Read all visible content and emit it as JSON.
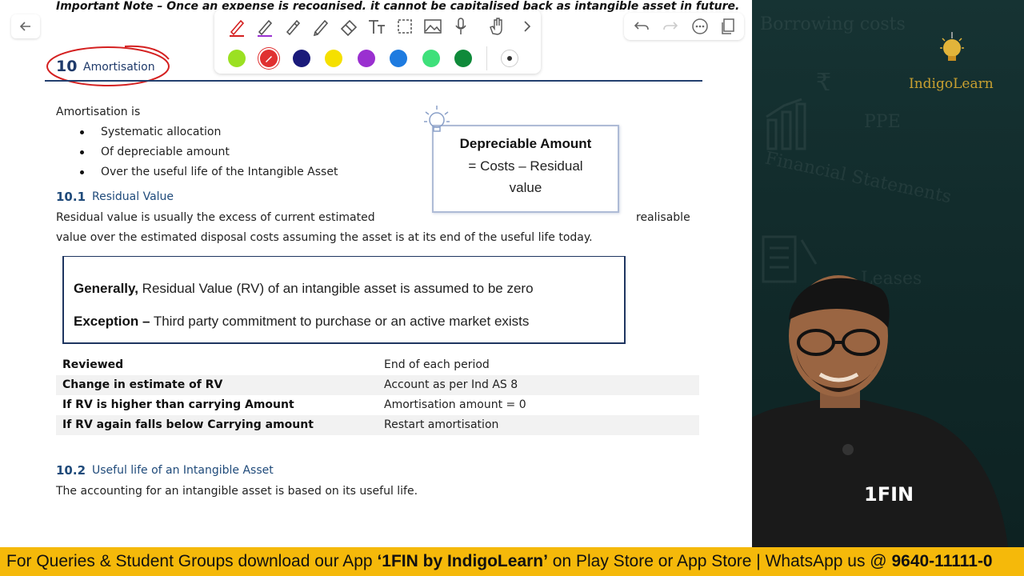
{
  "important_note": "Important Note – Once an expense is recognised, it cannot be capitalised back as intangible asset in future.",
  "section": {
    "number": "10",
    "title": "Amortisation"
  },
  "amortisation": {
    "intro": "Amortisation is",
    "bullets": [
      "Systematic allocation",
      "Of depreciable amount",
      "Over the useful life of the Intangible Asset"
    ]
  },
  "formula": {
    "title": "Depreciable Amount",
    "line2": "= Costs – Residual",
    "line3": "value"
  },
  "sub1": {
    "number": "10.1",
    "title": "Residual Value"
  },
  "residual_text": {
    "line1a": "Residual value is usually the excess of current estimated",
    "line1b": "realisable",
    "line2": "value over the estimated disposal costs assuming the asset is at its end of the useful life today."
  },
  "general_box": {
    "line1_bold": "Generally,",
    "line1_rest": " Residual Value (RV) of an intangible asset is assumed to be zero",
    "line2_bold": "Exception –",
    "line2_rest": " Third party commitment to purchase or an active market exists"
  },
  "table": [
    {
      "a": "Reviewed",
      "b": "End of each period"
    },
    {
      "a": "Change in estimate of RV",
      "b": "Account as per Ind AS 8"
    },
    {
      "a": "If RV is higher than carrying Amount",
      "b": "Amortisation amount = 0"
    },
    {
      "a": "If RV again falls below Carrying amount",
      "b": "Restart amortisation"
    }
  ],
  "sub2": {
    "number": "10.2",
    "title": "Useful life of an Intangible Asset"
  },
  "useful_life_text": "The accounting for an intangible asset is based on its useful life.",
  "toolbar": {
    "tools": [
      "pen-icon",
      "highlighter-icon",
      "marker-icon",
      "pencil-icon",
      "eraser-icon",
      "text-icon",
      "select-icon",
      "image-icon",
      "mic-icon",
      "hand-icon",
      "chevron-right-icon"
    ],
    "colors": [
      "#9be022",
      "#e03030",
      "#1a1a7a",
      "#f5e000",
      "#9a30d0",
      "#1e7be0",
      "#3ee07a",
      "#0f8a3a"
    ],
    "selected_color": "#e03030"
  },
  "video": {
    "brand": "IndigoLearn",
    "shirt_logo": "1FIN",
    "watermarks": [
      "Borrowing costs",
      "₹",
      "PPE",
      "Financial Statements",
      "Leases"
    ]
  },
  "banner": {
    "part1": "For Queries & Student Groups download our App ",
    "part2": "‘1FIN by IndigoLearn’",
    "part3": " on Play Store or App Store | WhatsApp us @ ",
    "part4": "9640-11111-0"
  }
}
